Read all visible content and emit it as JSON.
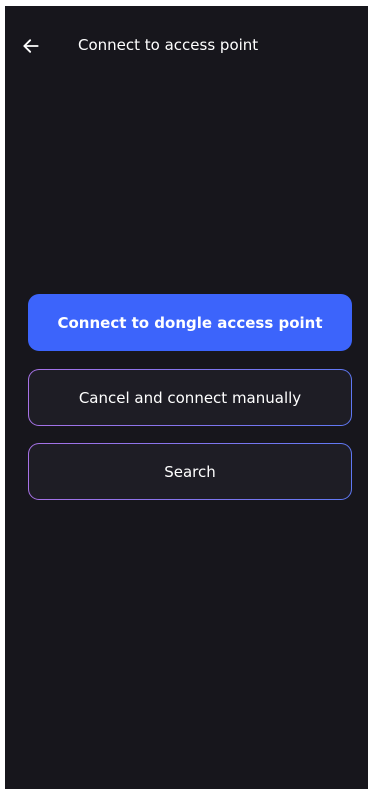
{
  "header": {
    "back_icon": "arrow-left-icon",
    "title": "Connect to access point"
  },
  "actions": {
    "connect_dongle_label": "Connect to dongle access point",
    "cancel_manual_label": "Cancel and connect manually",
    "search_label": "Search"
  },
  "colors": {
    "background": "#17161c",
    "primary": "#3c64fb",
    "outline_gradient_start": "#a772e6",
    "outline_gradient_end": "#5f78f4",
    "outline_fill": "#1e1d25",
    "text": "#ffffff"
  }
}
